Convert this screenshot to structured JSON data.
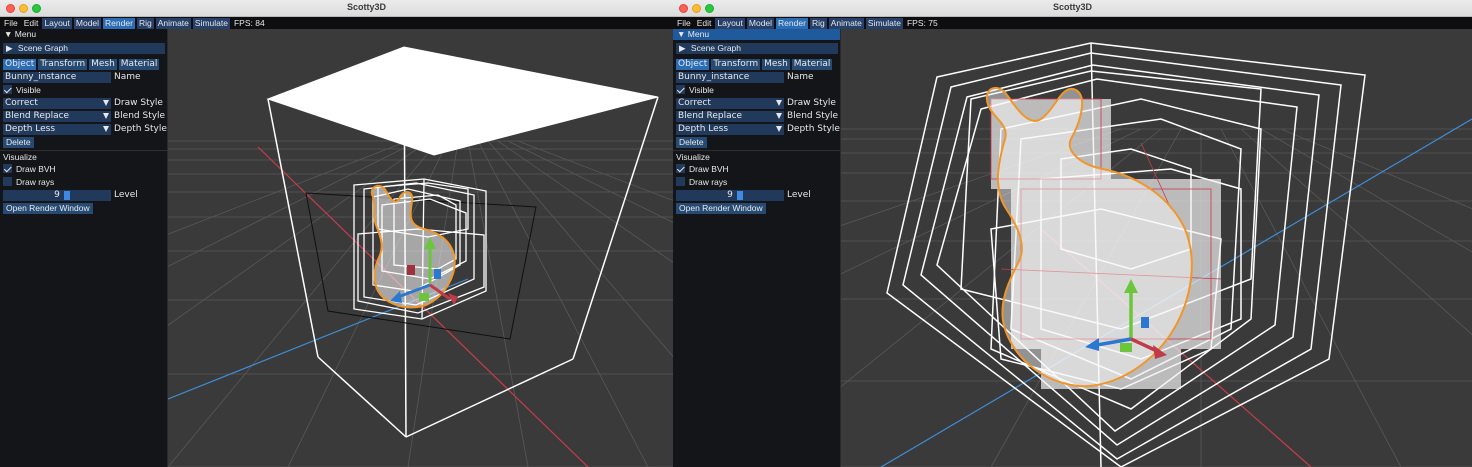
{
  "app": {
    "title": "Scotty3D"
  },
  "menu": {
    "items": [
      "File",
      "Edit",
      "Layout",
      "Model",
      "Render",
      "Rig",
      "Animate",
      "Simulate"
    ]
  },
  "windows": [
    {
      "fps": "FPS: 84",
      "panel": {
        "header": "Menu",
        "scene_graph": "Scene Graph",
        "tabs": [
          "Object",
          "Transform",
          "Mesh",
          "Material"
        ],
        "name_value": "Bunny_instance",
        "name_label": "Name",
        "visible_label": "Visible",
        "draw_style_value": "Correct",
        "draw_style_label": "Draw Style",
        "blend_style_value": "Blend Replace",
        "blend_style_label": "Blend Style",
        "depth_style_value": "Depth Less",
        "depth_style_label": "Depth Style",
        "delete_label": "Delete",
        "visualize_label": "Visualize",
        "draw_bvh_label": "Draw BVH",
        "draw_rays_label": "Draw rays",
        "level_value": "9",
        "level_label": "Level",
        "open_render_label": "Open Render Window"
      }
    },
    {
      "fps": "FPS: 75",
      "panel": {
        "header": "Menu",
        "scene_graph": "Scene Graph",
        "tabs": [
          "Object",
          "Transform",
          "Mesh",
          "Material"
        ],
        "name_value": "Bunny_instance",
        "name_label": "Name",
        "visible_label": "Visible",
        "draw_style_value": "Correct",
        "draw_style_label": "Draw Style",
        "blend_style_value": "Blend Replace",
        "blend_style_label": "Blend Style",
        "depth_style_value": "Depth Less",
        "depth_style_label": "Depth Style",
        "delete_label": "Delete",
        "visualize_label": "Visualize",
        "draw_bvh_label": "Draw BVH",
        "draw_rays_label": "Draw rays",
        "level_value": "9",
        "level_label": "Level",
        "open_render_label": "Open Render Window"
      }
    }
  ],
  "colors": {
    "viewport_bg": "#3a3a3a",
    "grid": "#5a5a5a",
    "x_axis": "#c83c4c",
    "z_axis": "#3c8ed8",
    "bvh_box": "#ffffff",
    "bunny_outline": "#f0962a",
    "gizmo_green": "#6cc63c",
    "gizmo_red": "#c03a48",
    "gizmo_blue": "#2a78d0",
    "active_menu": "#2a6cb5",
    "button": "#274a73"
  }
}
